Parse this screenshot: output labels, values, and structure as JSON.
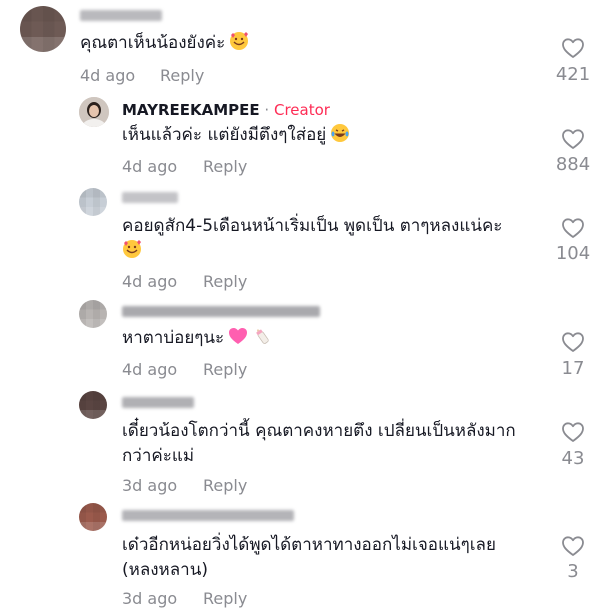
{
  "comments": [
    {
      "text": "คุณตาเห็นน้องยังค่ะ",
      "emoji": "smiling-face-with-hearts",
      "time": "4d ago",
      "reply": "Reply",
      "likes": "421"
    },
    {
      "username": "MAYREEKAMPEE",
      "separator": " · ",
      "badge": "Creator",
      "text": "เห็นแล้วค่ะ แต่ยังมีตึงๆใส่อยู่",
      "emoji": "laughing-face",
      "time": "4d ago",
      "reply": "Reply",
      "likes": "884"
    },
    {
      "text": "คอยดูสัก4-5เดือนหน้าเริ่มเป็น พูดเป็น ตาๆหลงแน่คะ",
      "emoji": "smiling-face-with-hearts",
      "time": "4d ago",
      "reply": "Reply",
      "likes": "104"
    },
    {
      "text": "หาตาบ่อยๆนะ",
      "emoji": "pink-heart and baby-bottle",
      "time": "4d ago",
      "reply": "Reply",
      "likes": "17"
    },
    {
      "text_line1": "เดี๋ยวน้องโตกว่านี้ คุณตาคงหายตึง เปลี่ยนเป็นหลังมาก",
      "text_line2": "กว่าค่ะแม่",
      "time": "3d ago",
      "reply": "Reply",
      "likes": "43"
    },
    {
      "text_line1": "เด๋วอีกหน่อยวิ่งได้พูดได้ตาหาทางออกไม่เจอแน่ๆเลย",
      "text_line2": "(หลงหลาน)",
      "time": "3d ago",
      "reply": "Reply",
      "likes": "3"
    }
  ],
  "icons": {
    "like": "heart-outline-icon"
  },
  "colors": {
    "creator": "#fe2c55",
    "muted": "#8a8b91",
    "text": "#161823"
  }
}
